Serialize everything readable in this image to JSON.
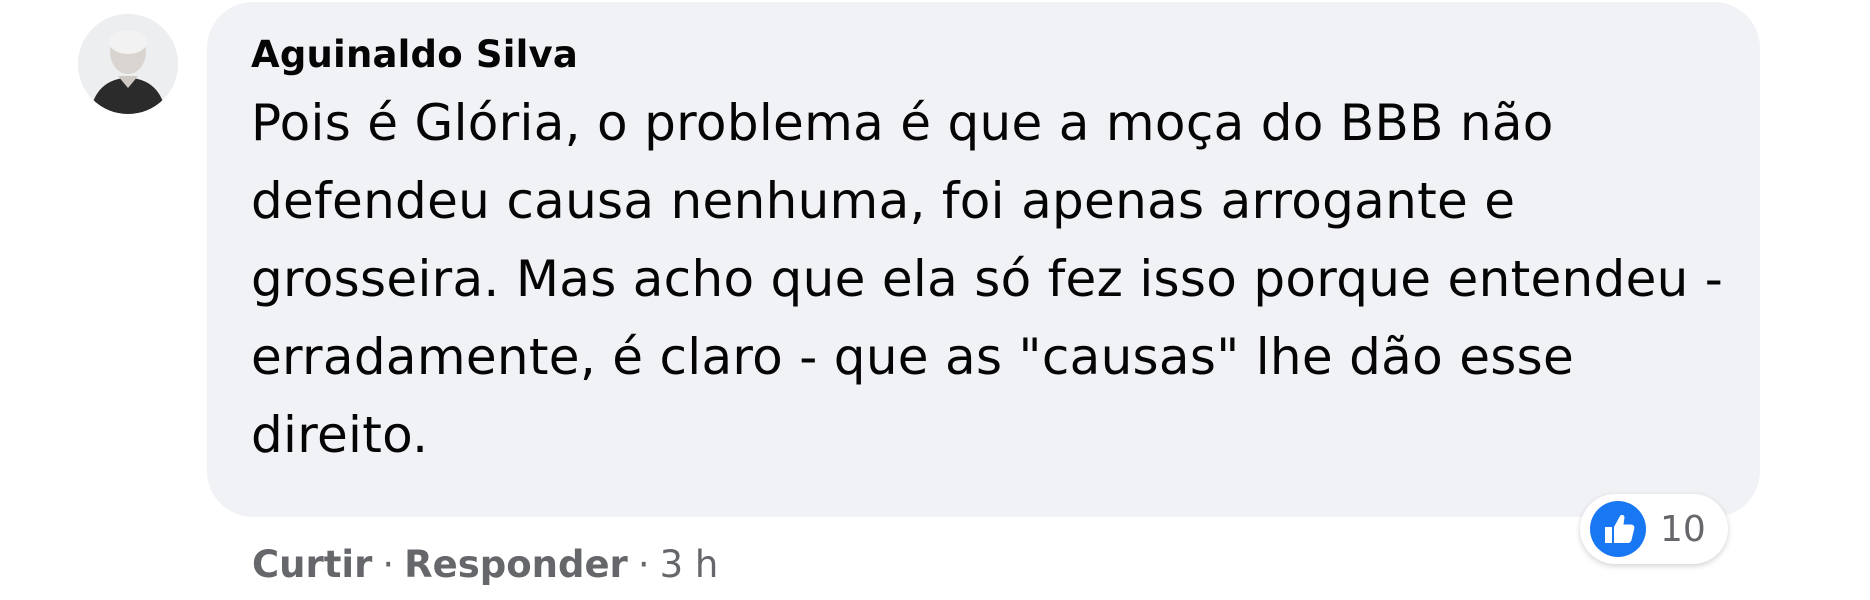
{
  "comment": {
    "author": "Aguinaldo Silva",
    "text": "Pois é Glória, o problema é que a moça do BBB não defendeu causa nenhuma, foi apenas arrogante e grosseira. Mas acho que ela só fez isso porque entendeu - erradamente, é claro - que as \"causas\" lhe dão esse direito."
  },
  "reactions": {
    "icon": "like-icon",
    "color": "#1877f2",
    "count": "10"
  },
  "actions": {
    "like_label": "Curtir",
    "separator": "·",
    "reply_label": "Responder",
    "timestamp": "3 h"
  },
  "colors": {
    "bubble": "#f0f2f5",
    "text": "#050505",
    "secondary": "#65676b",
    "like_blue": "#1877f2"
  }
}
